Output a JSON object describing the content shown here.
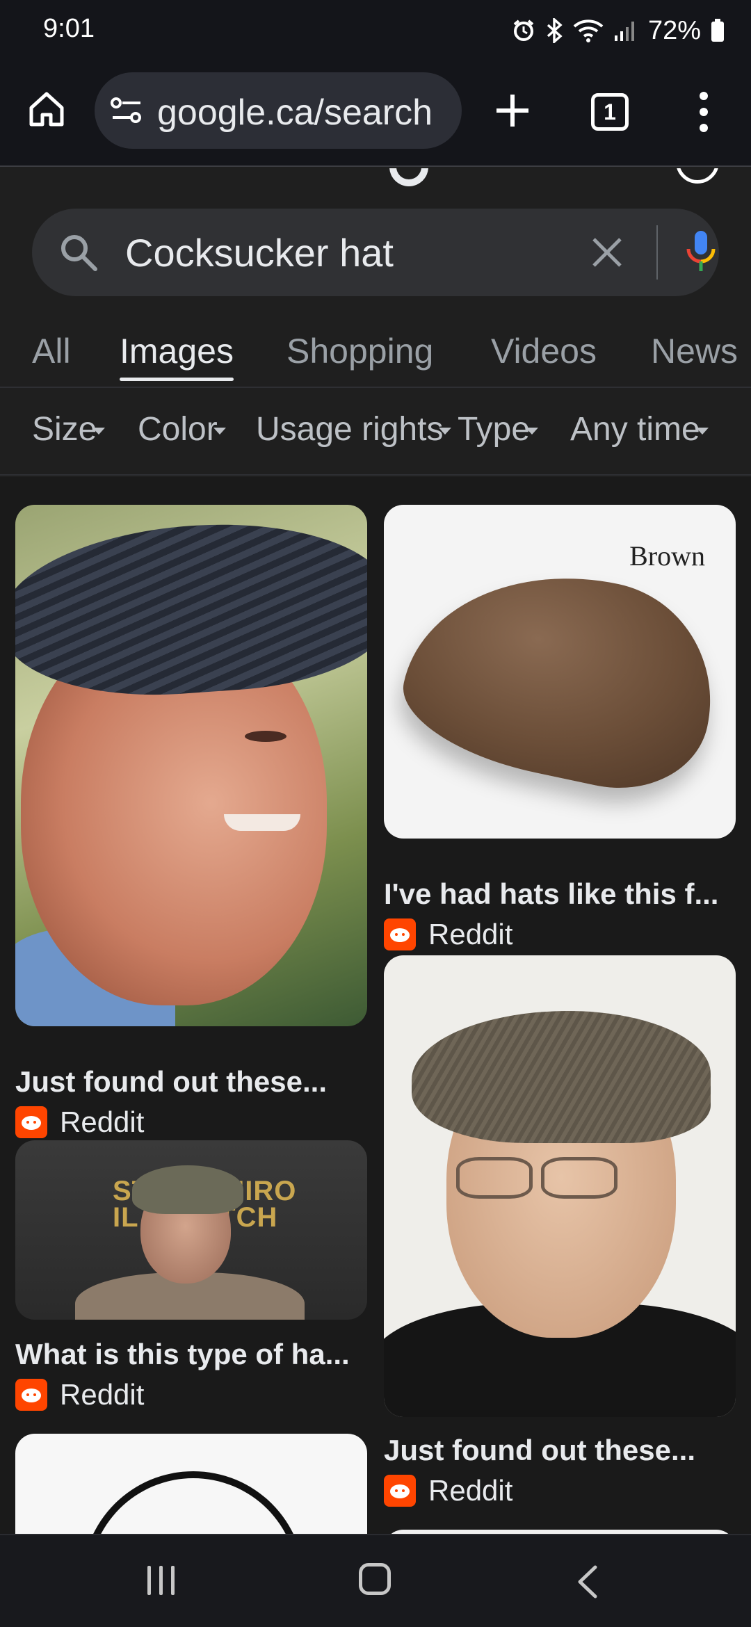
{
  "status_bar": {
    "time": "9:01",
    "battery": "72%",
    "icons": [
      "alarm-icon",
      "bluetooth-icon",
      "wifi-icon",
      "signal-icon",
      "battery-icon"
    ]
  },
  "browser": {
    "url": "google.ca/search",
    "tab_count": "1",
    "icons": [
      "home-icon",
      "site-settings-icon",
      "plus-icon",
      "tab-switcher-icon",
      "more-vert-icon"
    ]
  },
  "search": {
    "query": "Cocksucker hat",
    "icons": [
      "search-icon",
      "clear-icon",
      "mic-icon"
    ]
  },
  "nav_tabs": [
    {
      "label": "All"
    },
    {
      "label": "Images",
      "active": true
    },
    {
      "label": "Shopping"
    },
    {
      "label": "Videos"
    },
    {
      "label": "News"
    }
  ],
  "filters": [
    {
      "label": "Size"
    },
    {
      "label": "Color"
    },
    {
      "label": "Usage rights"
    },
    {
      "label": "Type"
    },
    {
      "label": "Any time"
    }
  ],
  "results": [
    {
      "caption": "Just found out these...",
      "source": "Reddit"
    },
    {
      "caption": "I've had hats like this f...",
      "source": "Reddit",
      "image_text": "Brown"
    },
    {
      "caption": "What is this type of ha...",
      "source": "Reddit",
      "image_text_line1": "STA      DE NIRO",
      "image_text_line2": "IL C     MATCH"
    },
    {
      "caption": "Just found out these...",
      "source": "Reddit"
    }
  ],
  "colors": {
    "background": "#1f1f1f",
    "search_box": "#303134",
    "reddit": "#ff4500",
    "toolbar": "#14151a"
  }
}
